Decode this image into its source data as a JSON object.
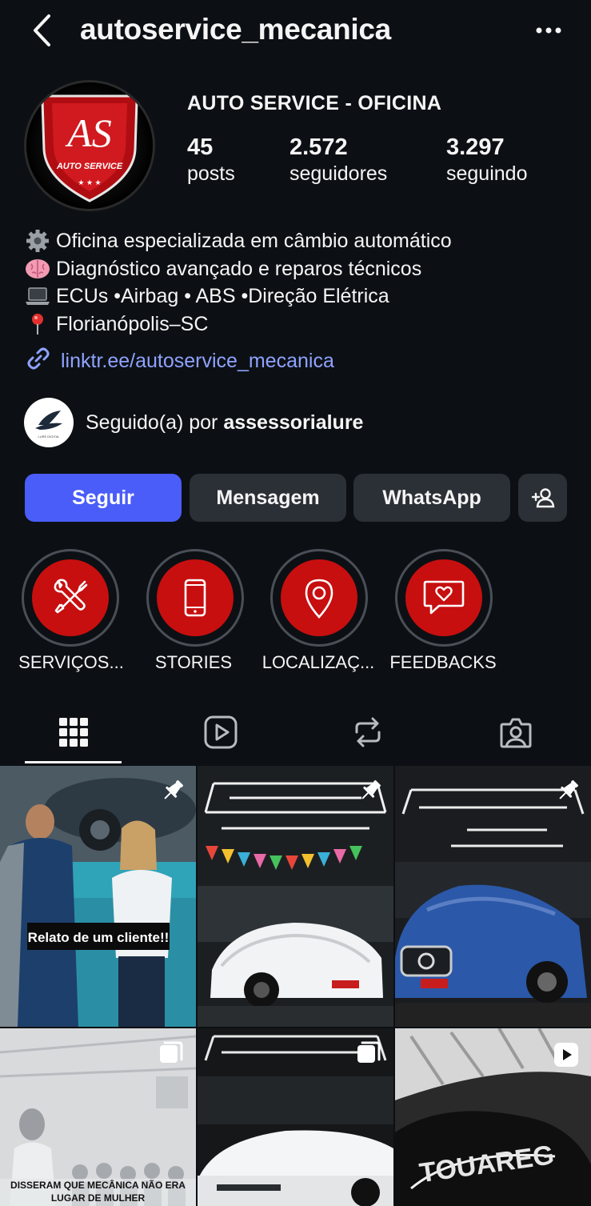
{
  "header": {
    "username": "autoservice_mecanica"
  },
  "profile": {
    "avatar_text": "AS",
    "avatar_subtext": "AUTO SERVICE",
    "display_name": "AUTO SERVICE - OFICINA",
    "stats": [
      {
        "value": "45",
        "label": "posts"
      },
      {
        "value": "2.572",
        "label": "seguidores"
      },
      {
        "value": "3.297",
        "label": "seguindo"
      }
    ],
    "bio": [
      {
        "icon": "gear-icon",
        "text": "Oficina especializada em câmbio automático"
      },
      {
        "icon": "brain-icon",
        "text": "Diagnóstico avançado e reparos técnicos"
      },
      {
        "icon": "laptop-icon",
        "text": "ECUs •Airbag • ABS •Direção Elétrica"
      },
      {
        "icon": "pin-icon",
        "text": "Florianópolis–SC"
      }
    ],
    "link": "linktr.ee/autoservice_mecanica",
    "followed_by_prefix": "Seguido(a) por ",
    "followed_by_user": "assessorialure",
    "followed_by_avatar_text": "LURE DIGITAL"
  },
  "actions": {
    "follow": "Seguir",
    "message": "Mensagem",
    "whatsapp": "WhatsApp"
  },
  "highlights": [
    {
      "label": "SERVIÇOS...",
      "icon": "tools-icon"
    },
    {
      "label": "STORIES",
      "icon": "phone-icon"
    },
    {
      "label": "LOCALIZAÇ...",
      "icon": "location-icon"
    },
    {
      "label": "FEEDBACKS",
      "icon": "chat-heart-icon"
    }
  ],
  "tabs": [
    "grid-icon",
    "reels-icon",
    "reposts-icon",
    "tagged-icon"
  ],
  "posts": [
    {
      "caption": "Relato de um cliente!!",
      "badge": "pinned"
    },
    {
      "caption": "",
      "badge": "pinned"
    },
    {
      "caption": "",
      "badge": "pinned"
    },
    {
      "caption": "DISSERAM QUE MECÂNICA NÃO ERA LUGAR DE MULHER",
      "badge": "carousel"
    },
    {
      "caption": "",
      "badge": "carousel"
    },
    {
      "caption": "",
      "badge": "reel"
    }
  ],
  "colors": {
    "background": "#0c1014",
    "primary_button": "#4a5df9",
    "secondary_button": "#2b3036",
    "link": "#8fa2ff",
    "highlight_red": "#c70f0f"
  }
}
